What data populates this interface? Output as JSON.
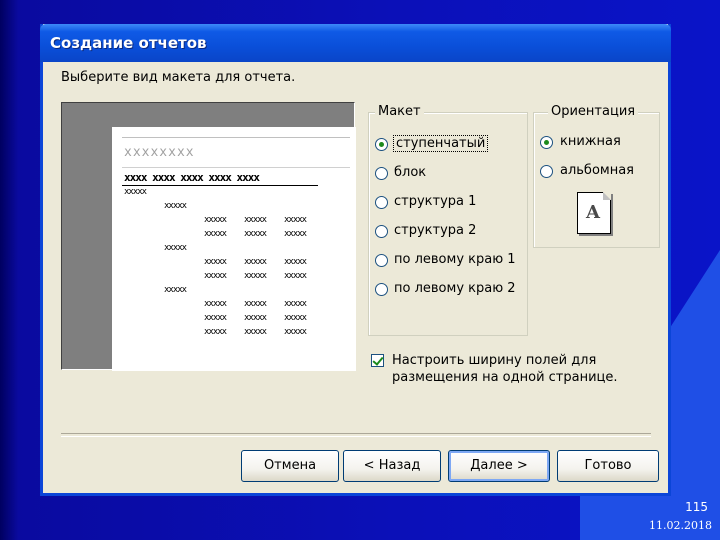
{
  "slide": {
    "page_number": "115",
    "date": "11.02.2018"
  },
  "window": {
    "title": "Создание отчетов",
    "prompt": "Выберите вид макета для отчета."
  },
  "preview": {
    "header_text": "xxxxxxxx",
    "columns_text": "xxxx xxxx xxxx xxxx xxxx",
    "cell_text": "xxxxx"
  },
  "layout_group": {
    "legend": "Макет",
    "options": [
      {
        "label": "ступенчатый",
        "selected": true
      },
      {
        "label": "блок",
        "selected": false
      },
      {
        "label": "структура 1",
        "selected": false
      },
      {
        "label": "структура 2",
        "selected": false
      },
      {
        "label": "по левому краю 1",
        "selected": false
      },
      {
        "label": "по левому краю 2",
        "selected": false
      }
    ]
  },
  "orientation_group": {
    "legend": "Ориентация",
    "options": [
      {
        "label": "книжная",
        "selected": true
      },
      {
        "label": "альбомная",
        "selected": false
      }
    ],
    "icon_letter": "A"
  },
  "fit_checkbox": {
    "checked": true,
    "line1": "Настроить ширину полей для",
    "line2": "размещения на одной странице."
  },
  "buttons": {
    "cancel": "Отмена",
    "back": "< Назад",
    "next": "Далее >",
    "finish": "Готово"
  }
}
